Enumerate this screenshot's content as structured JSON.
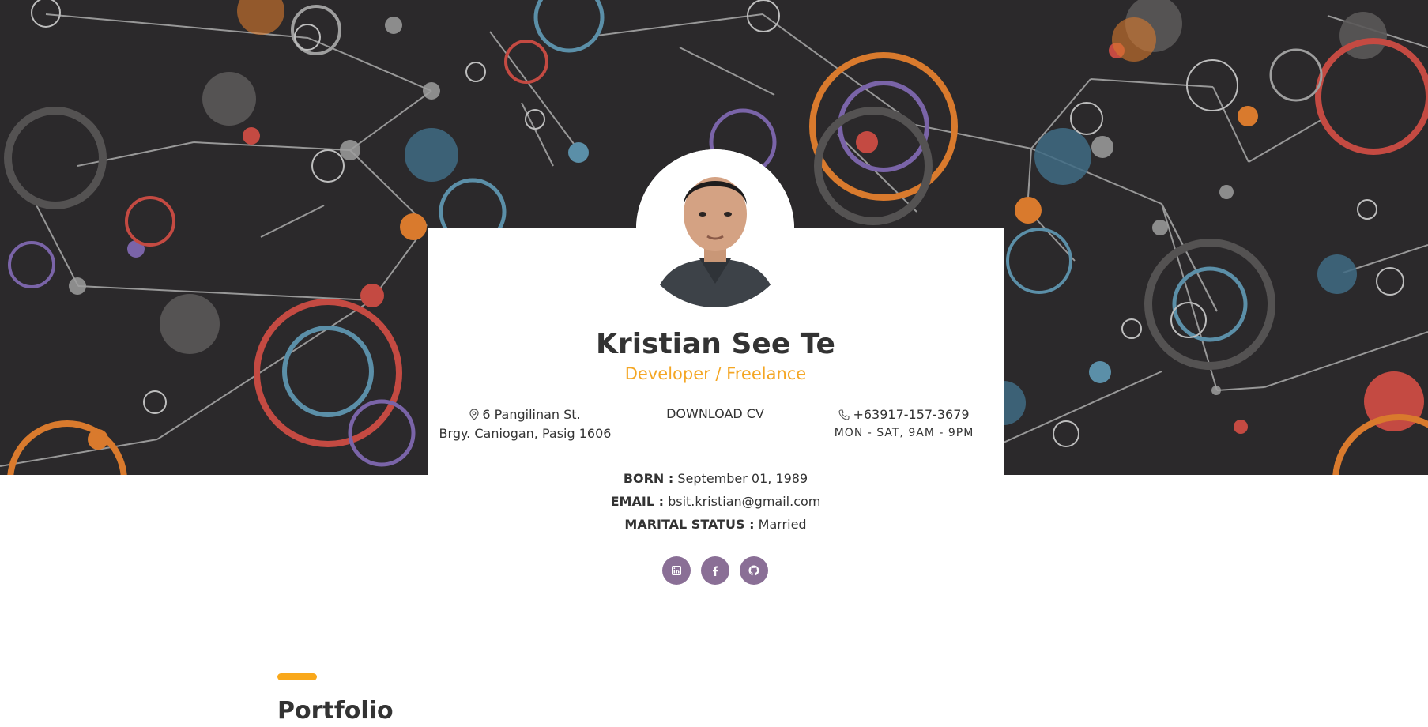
{
  "profile": {
    "name": "Kristian See Te",
    "role": "Developer / Freelance",
    "address_line1": "6 Pangilinan St.",
    "address_line2": "Brgy. Caniogan, Pasig 1606",
    "download_label": "DOWNLOAD CV",
    "phone": "+63917-157-3679",
    "hours": "MON - SAT, 9AM - 9PM"
  },
  "details": {
    "born_label": "BORN :",
    "born_value": "September 01, 1989",
    "email_label": "EMAIL :",
    "email_value": "bsit.kristian@gmail.com",
    "marital_label": "MARITAL STATUS :",
    "marital_value": "Married"
  },
  "socials": [
    {
      "icon": "linkedin-icon"
    },
    {
      "icon": "facebook-icon"
    },
    {
      "icon": "github-icon"
    }
  ],
  "sections": {
    "portfolio_title": "Portfolio"
  },
  "colors": {
    "hero_background": "#2b292b",
    "accent": "#f4a623",
    "social_button": "#8a6f96",
    "text": "#333333"
  }
}
